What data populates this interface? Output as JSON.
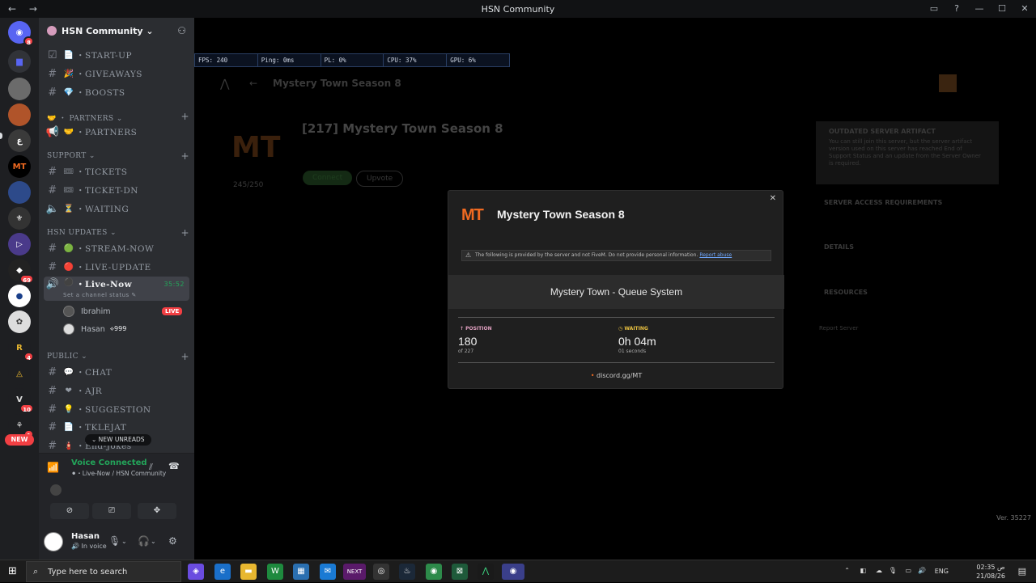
{
  "window": {
    "title": "HSN Community",
    "nav": "← →",
    "controls": [
      "▭",
      "?",
      "—",
      "☐",
      "✕"
    ]
  },
  "guilds": {
    "home_badge": "8",
    "badges": [
      "4",
      "69",
      "4",
      "10",
      "1"
    ],
    "new_label": "NEW"
  },
  "server": {
    "name": "HSN Community ⌄"
  },
  "channels": [
    {
      "emoji": "📄",
      "name": "・START-UP"
    },
    {
      "emoji": "🎉",
      "name": "・GIVEAWAYS"
    },
    {
      "emoji": "💎",
      "name": "・BOOSTS"
    },
    {
      "emoji": "🤝",
      "name": "・PARTNERS"
    },
    {
      "emoji": "🎟",
      "name": "・TICKETS"
    },
    {
      "emoji": "🎟",
      "name": "・TICKET-DN"
    },
    {
      "emoji": "⏳",
      "name": "・WAITING"
    },
    {
      "emoji": "🟢",
      "name": "・STREAM-NOW"
    },
    {
      "emoji": "🔴",
      "name": "・LIVE-UPDATE"
    },
    {
      "emoji": "⚫",
      "name": "・Live-Now"
    },
    {
      "emoji": "💬",
      "name": "・CHAT"
    },
    {
      "emoji": "❤",
      "name": "・AJR"
    },
    {
      "emoji": "💡",
      "name": "・SUGGESTION"
    },
    {
      "emoji": "📄",
      "name": "・TKLEJAT"
    },
    {
      "emoji": "🧯",
      "name": "・End-Jokes"
    }
  ],
  "categories": {
    "partners": "🤝 ・ PARTNERS ⌄",
    "support": "SUPPORT ⌄",
    "updates": "HSN UPDATES ⌄",
    "public": "PUBLIC ⌄"
  },
  "live_now": {
    "timer": "35:52",
    "status": "Set a channel status ✎"
  },
  "voice_users": [
    {
      "name": "Ibrahim",
      "tag": "LIVE"
    },
    {
      "name": "Hasan",
      "tag": "⟡999"
    }
  ],
  "new_unreads": "⌄ NEW UNREADS",
  "voice": {
    "status": "Voice Connected",
    "sub": "⚫・Live-Now / HSN Community"
  },
  "user": {
    "name": "Hasan",
    "status": "🔊 In voice"
  },
  "overlay": {
    "fps": "FPS: 240",
    "ping": "Ping: 0ms",
    "pl": "PL: 0%",
    "cpu": "CPU: 37%",
    "gpu": "GPU: 6%"
  },
  "background": {
    "header": "Mystery Town Season 8",
    "server_title": "[217] Mystery Town Season 8",
    "players": "245/250",
    "connect": "Connect",
    "upvote": "Upvote",
    "outdated_title": "OUTDATED SERVER ARTIFACT",
    "outdated_text": "You can still join this server, but the server artifact version used on this server has reached End of Support Status and an update from the Server Owner is required.",
    "access": "SERVER ACCESS REQUIREMENTS",
    "details": "DETAILS",
    "resources": "RESOURCES",
    "report": "Report Server"
  },
  "modal": {
    "logo": "MT",
    "title": "Mystery Town Season 8",
    "close": "✕",
    "warning": "The following is provided by the server and not FiveM. Do not provide personal information.",
    "report": "Report abuse",
    "queue": "Mystery Town - Queue System",
    "pos_label": "↑ POSITION",
    "pos_value": "180",
    "pos_sub": "of 227",
    "wait_label": "◷ WAITING",
    "wait_value": "0h 04m",
    "wait_sub": "01 seconds",
    "link": "discord.gg/MT"
  },
  "version": "Ver. 35227",
  "taskbar": {
    "search": "Type here to search",
    "lang": "ENG",
    "time": "02:35 ص",
    "date": "21/08/26"
  }
}
